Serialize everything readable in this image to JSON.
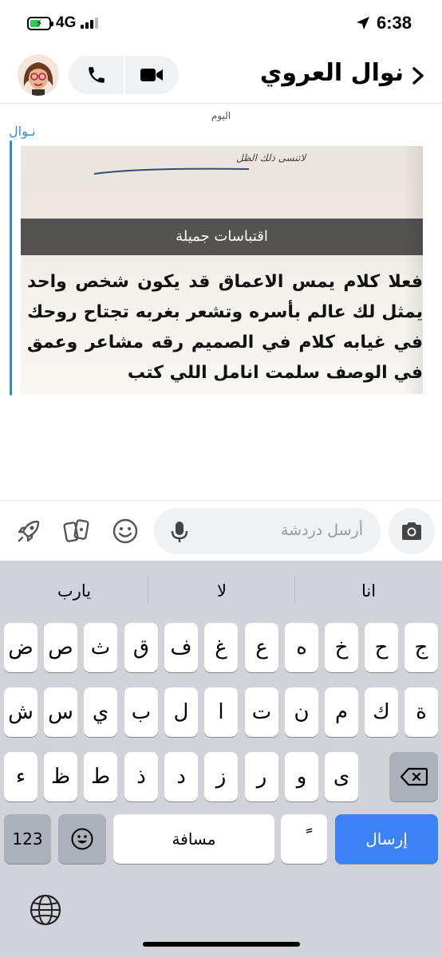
{
  "status_bar": {
    "network": "4G",
    "time": "6:38"
  },
  "header": {
    "contact_name": "نوال العروي"
  },
  "chat": {
    "day_label": "اليوم",
    "sender": "نـوال",
    "snap": {
      "handwriting": "لاتنسى ذلك الظل",
      "caption": "اقتباسات جميلة",
      "text": "فعلا كلام يمس الاعماق قد يكون شخص واحد يمثل لك عالم بأسره وتشعر بغربه تجتاح روحك في غيابه كلام في الصميم رقه مشاعر وعمق في الوصف سلمت انامل اللي كتب"
    }
  },
  "input": {
    "placeholder": "أرسل دردشة"
  },
  "keyboard": {
    "suggestions": [
      "انا",
      "لا",
      "يارب"
    ],
    "row1": [
      "ج",
      "ح",
      "خ",
      "ه",
      "ع",
      "غ",
      "ف",
      "ق",
      "ث",
      "ص",
      "ض"
    ],
    "row2": [
      "ة",
      "ك",
      "م",
      "ن",
      "ت",
      "ا",
      "ل",
      "ب",
      "ي",
      "س",
      "ش"
    ],
    "row3": [
      "ى",
      "و",
      "ر",
      "ز",
      "د",
      "ذ",
      "ط",
      "ظ",
      "ء"
    ],
    "numbers_label": "123",
    "space_label": "مسافة",
    "diacritic_label": "ً",
    "send_label": "إرسال"
  },
  "colors": {
    "accent": "#2e8cd8",
    "send_key": "#3e82f7",
    "keyboard_bg": "#d1d3d9",
    "battery": "#34c759"
  },
  "icons": [
    "battery-icon",
    "signal-icon",
    "location-arrow-icon",
    "chevron-left-icon",
    "phone-icon",
    "video-icon",
    "bitmoji-avatar",
    "rocket-icon",
    "cards-icon",
    "smile-icon",
    "microphone-icon",
    "camera-icon",
    "backspace-icon",
    "emoji-icon",
    "globe-icon"
  ]
}
